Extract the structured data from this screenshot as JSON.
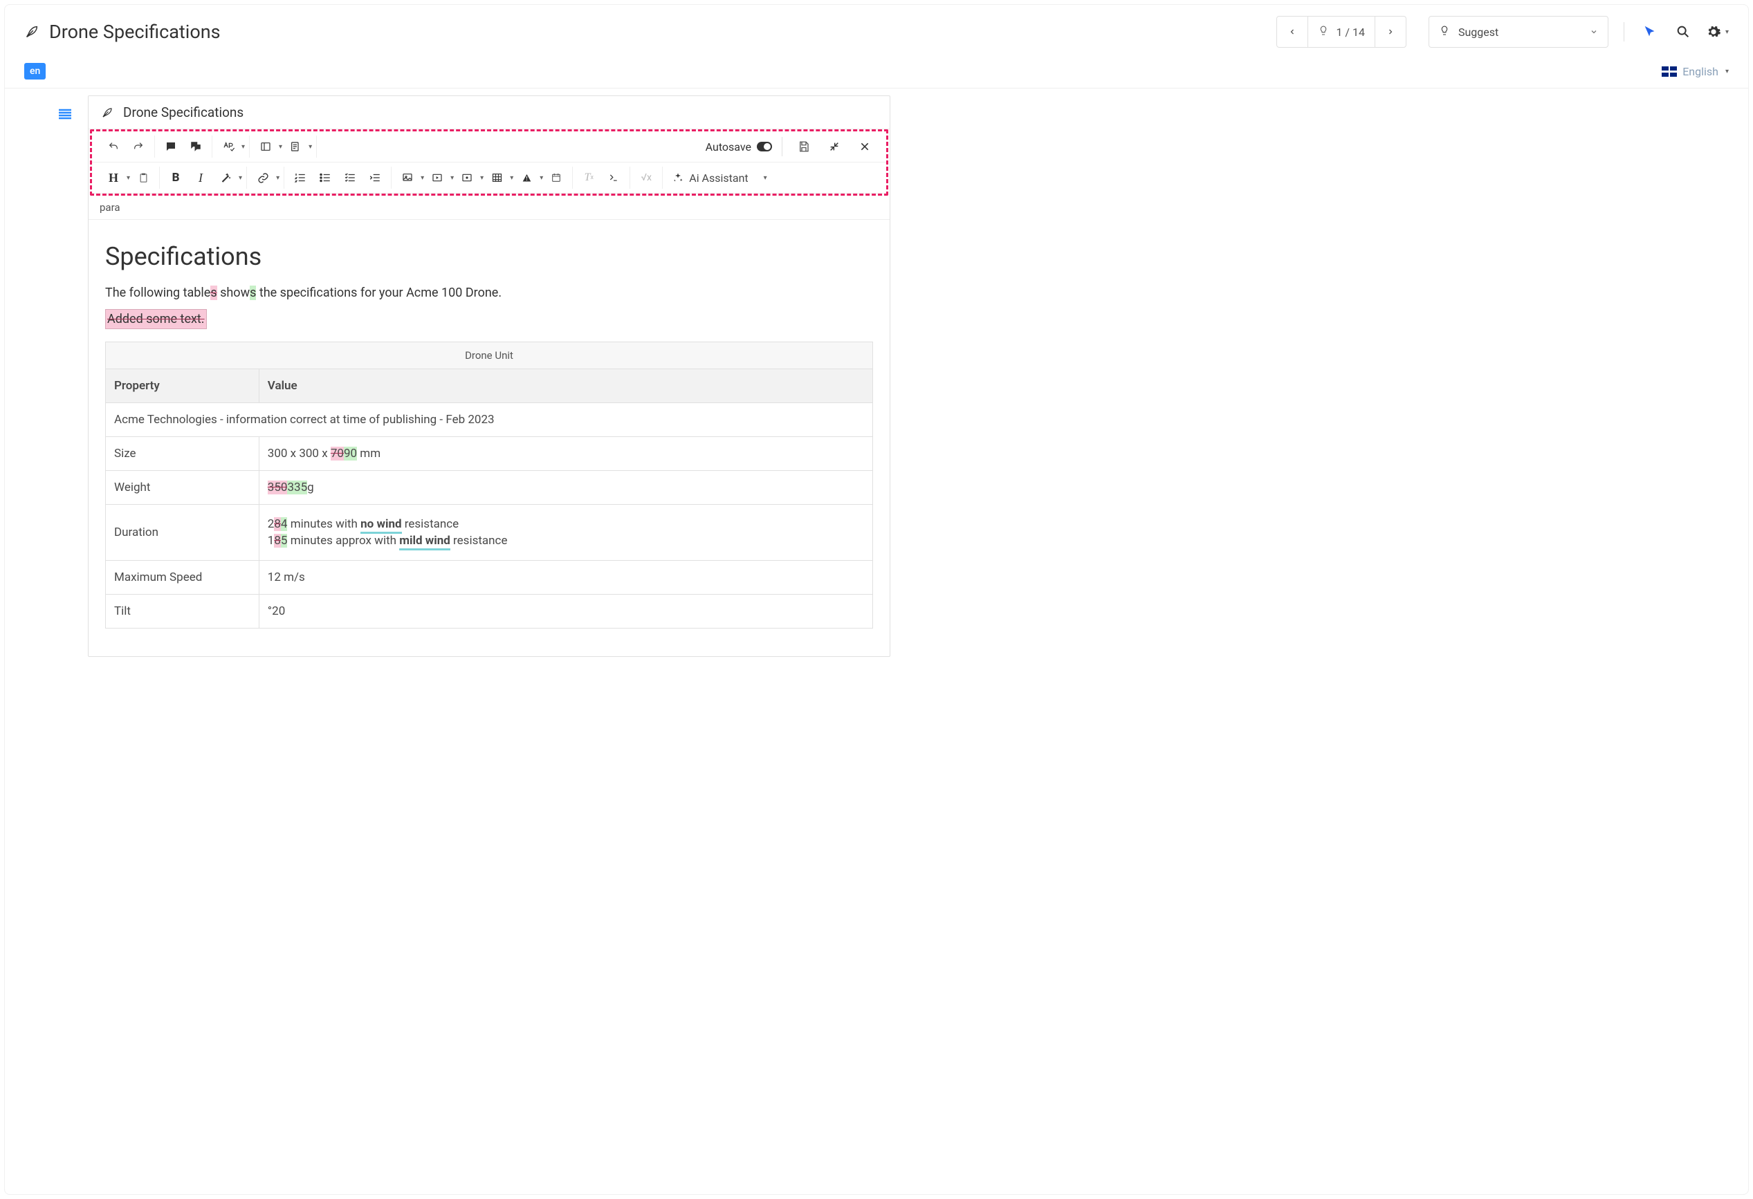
{
  "header": {
    "title": "Drone Specifications",
    "pagination": "1 / 14",
    "mode_label": "Suggest",
    "language_label": "English"
  },
  "lang_chip": "en",
  "editor": {
    "title": "Drone Specifications",
    "autosave_label": "Autosave",
    "ai_label": "Ai Assistant",
    "breadcrumb": "para"
  },
  "content": {
    "heading": "Specifications",
    "intro_pre": "The following table",
    "intro_del1": "s",
    "intro_mid": " show",
    "intro_ins1": "s",
    "intro_post": " the specifications for your Acme 100 Drone.",
    "added_block": "Added some text.",
    "table_caption": "Drone Unit",
    "col_property": "Property",
    "col_value": "Value",
    "disclaimer": "Acme Technologies - information correct at time of publishing - Feb 2023",
    "rows": {
      "size": {
        "label": "Size",
        "pre": "300 x 300 x ",
        "del": "70",
        "ins": "90",
        "post": " mm"
      },
      "weight": {
        "label": "Weight",
        "del": "350",
        "ins": "335",
        "post": "g"
      },
      "duration": {
        "label": "Duration",
        "l1_pre": "2",
        "l1_del": "8",
        "l1_ins": "4",
        "l1_mid": " minutes with ",
        "l1_bold": "no wind",
        "l1_post": " resistance",
        "l2_pre": "1",
        "l2_del": "8",
        "l2_ins": "5",
        "l2_mid": " minutes approx with ",
        "l2_bold": "mild wind",
        "l2_post": " resistance"
      },
      "max_speed": {
        "label": "Maximum Speed",
        "value": "12 m/s"
      },
      "tilt": {
        "label": "Tilt",
        "value": "°20"
      }
    }
  }
}
